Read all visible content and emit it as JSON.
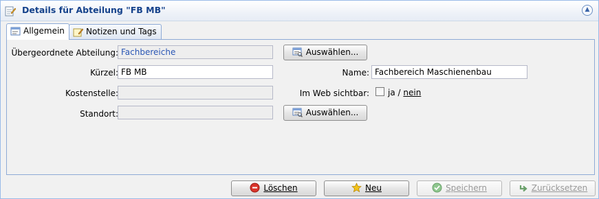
{
  "panel": {
    "title": "Details für Abteilung \"FB MB\"",
    "title_icon": "edit-form-icon",
    "collapse_icon": "collapse-up-icon"
  },
  "tabs": [
    {
      "label": "Allgemein",
      "icon": "form-icon",
      "active": true
    },
    {
      "label": "Notizen und Tags",
      "icon": "note-edit-icon",
      "active": false
    }
  ],
  "form": {
    "parent_label": "Übergeordnete Abteilung:",
    "parent_value": "Fachbereiche",
    "parent_select_label": "Auswählen...",
    "kuerzel_label": "Kürzel:",
    "kuerzel_value": "FB MB",
    "name_label": "Name:",
    "name_value": "Fachbereich Maschienenbau",
    "kostenstelle_label": "Kostenstelle:",
    "kostenstelle_value": "",
    "web_label": "Im Web sichtbar:",
    "web_yes": "ja",
    "web_sep": "/",
    "web_no": "nein",
    "standort_label": "Standort:",
    "standort_value": "",
    "standort_select_label": "Auswählen..."
  },
  "footer": {
    "delete_label": "Löschen",
    "new_label": "Neu",
    "save_label": "Speichern",
    "reset_label": "Zurücksetzen"
  },
  "colors": {
    "title": "#15428b",
    "border": "#99bbe8",
    "link": "#2a56b5",
    "delete": "#d9342b",
    "new": "#f2c21a",
    "save_disabled": "#8fc78f",
    "reset_disabled": "#8fc78f"
  }
}
